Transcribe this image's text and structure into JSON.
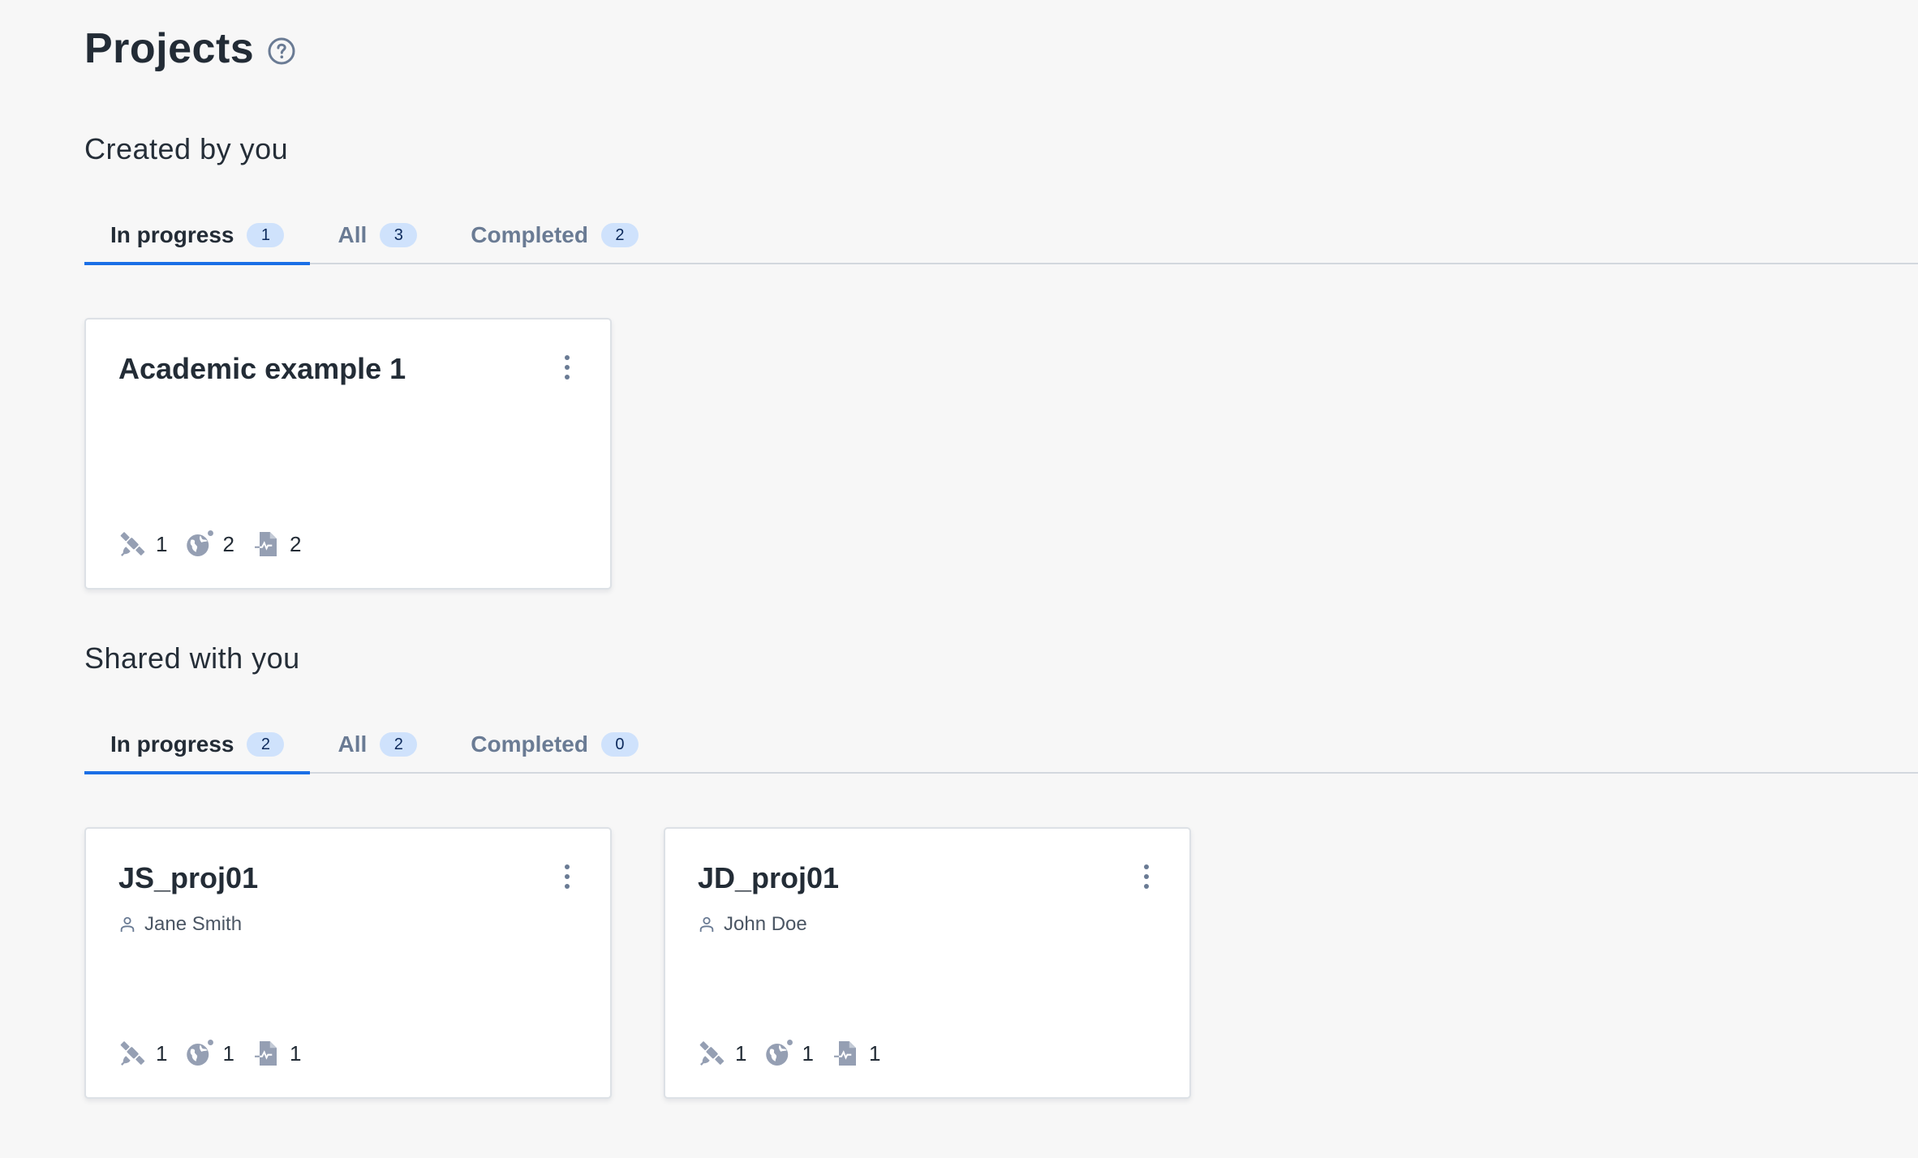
{
  "page": {
    "title": "Projects",
    "help_icon": "help-circle-icon"
  },
  "colors": {
    "background": "#f7f7f7",
    "accent": "#1a6fe6",
    "badge_bg": "#cfe2fc",
    "badge_text": "#0d2a5c",
    "icon_gray": "#959fb3",
    "muted_text": "#6a7b94"
  },
  "created": {
    "heading": "Created by you",
    "tabs": [
      {
        "label": "In progress",
        "count": "1",
        "active": true
      },
      {
        "label": "All",
        "count": "3",
        "active": false
      },
      {
        "label": "Completed",
        "count": "2",
        "active": false
      }
    ],
    "cards": [
      {
        "title": "Academic example 1",
        "owner": null,
        "stats": [
          {
            "icon": "satellite-icon",
            "value": "1"
          },
          {
            "icon": "globe-icon",
            "value": "2"
          },
          {
            "icon": "document-pulse-icon",
            "value": "2"
          }
        ]
      }
    ]
  },
  "shared": {
    "heading": "Shared with you",
    "tabs": [
      {
        "label": "In progress",
        "count": "2",
        "active": true
      },
      {
        "label": "All",
        "count": "2",
        "active": false
      },
      {
        "label": "Completed",
        "count": "0",
        "active": false
      }
    ],
    "cards": [
      {
        "title": "JS_proj01",
        "owner": "Jane Smith",
        "stats": [
          {
            "icon": "satellite-icon",
            "value": "1"
          },
          {
            "icon": "globe-icon",
            "value": "1"
          },
          {
            "icon": "document-pulse-icon",
            "value": "1"
          }
        ]
      },
      {
        "title": "JD_proj01",
        "owner": "John Doe",
        "stats": [
          {
            "icon": "satellite-icon",
            "value": "1"
          },
          {
            "icon": "globe-icon",
            "value": "1"
          },
          {
            "icon": "document-pulse-icon",
            "value": "1"
          }
        ]
      }
    ]
  }
}
